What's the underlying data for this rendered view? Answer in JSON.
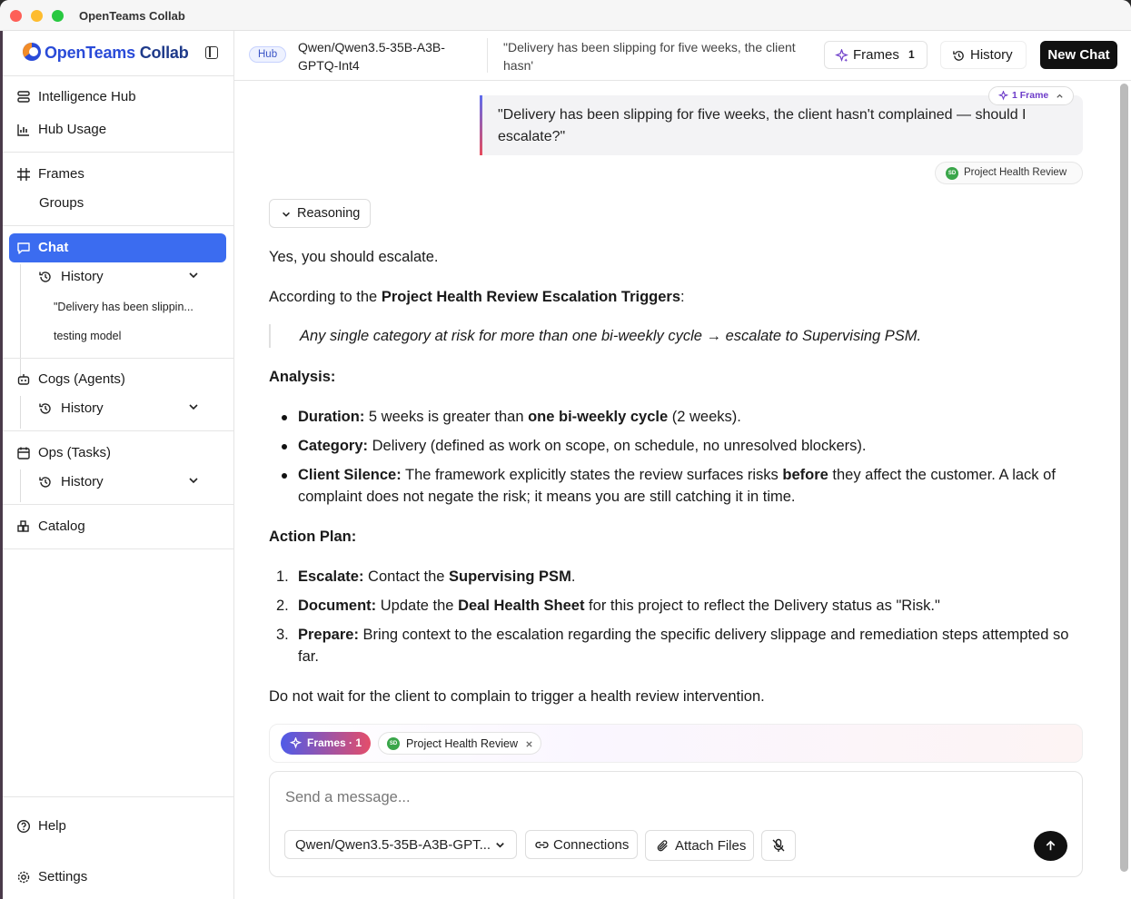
{
  "window": {
    "title": "OpenTeams Collab"
  },
  "colors": {
    "accent": "#3b6cf0",
    "dark_button": "#111111",
    "frames_gradient_start": "#4f5be8",
    "frames_gradient_end": "#e44d6a",
    "tag_green": "#3aa64a"
  },
  "sidebar": {
    "logo_open": "Open",
    "logo_teams": "Teams",
    "logo_collab": " Collab",
    "nav": [
      {
        "label": "Intelligence Hub",
        "icon": "database-icon"
      },
      {
        "label": "Hub Usage",
        "icon": "bar-chart-icon"
      },
      {
        "label": "Frames",
        "icon": "hash-frame-icon"
      },
      {
        "label": "Groups"
      },
      {
        "label": "Chat",
        "icon": "chat-bubble-icon"
      },
      {
        "label": "Cogs (Agents)",
        "icon": "robot-icon"
      },
      {
        "label": "Ops (Tasks)",
        "icon": "calendar-task-icon"
      },
      {
        "label": "Catalog",
        "icon": "catalog-grid-icon"
      },
      {
        "label": "Help",
        "icon": "help-circle-icon"
      },
      {
        "label": "Settings",
        "icon": "gear-icon"
      }
    ],
    "history_label": "History",
    "chat_history": [
      "\"Delivery has been slippin...",
      "testing model"
    ]
  },
  "topbar": {
    "hub_badge": "Hub",
    "model": "Qwen/Qwen3.5-35B-A3B-GPTQ-Int4",
    "conversation_title": "\"Delivery has been slipping for five weeks, the client hasn'",
    "frames_label": "Frames",
    "frames_count": "1",
    "history_label": "History",
    "new_chat_label": "New Chat"
  },
  "thread": {
    "frame_pill": "1 Frame",
    "user_message": "\"Delivery has been slipping for five weeks, the client hasn't complained — should I escalate?\"",
    "frame_tag_initials": "SD",
    "frame_tag": "Project Health Review",
    "reasoning_label": "Reasoning",
    "answer_intro": "Yes, you should escalate.",
    "according_prefix": "According to the ",
    "according_bold": "Project Health Review Escalation Triggers",
    "according_suffix": ":",
    "quote": "Any single category at risk for more than one bi-weekly cycle → escalate to Supervising PSM.",
    "analysis_heading": "Analysis:",
    "analysis": [
      {
        "b1": "Duration:",
        "t1": " 5 weeks is greater than ",
        "b2": "one bi-weekly cycle",
        "t2": " (2 weeks)."
      },
      {
        "b1": "Category:",
        "t1": " Delivery (defined as work on scope, on schedule, no unresolved blockers).",
        "b2": "",
        "t2": ""
      },
      {
        "b1": "Client Silence:",
        "t1": " The framework explicitly states the review surfaces risks ",
        "b2": "before",
        "t2": " they affect the customer. A lack of complaint does not negate the risk; it means you are still catching it in time."
      }
    ],
    "plan_heading": "Action Plan:",
    "plan": [
      {
        "n": "1.",
        "b1": "Escalate:",
        "t1": " Contact the ",
        "b2": "Supervising PSM",
        "t2": "."
      },
      {
        "n": "2.",
        "b1": "Document:",
        "t1": " Update the ",
        "b2": "Deal Health Sheet",
        "t2": " for this project to reflect the Delivery status as \"Risk.\""
      },
      {
        "n": "3.",
        "b1": "Prepare:",
        "t1": " Bring context to the escalation regarding the specific delivery slippage and remediation steps attempted so far.",
        "b2": "",
        "t2": ""
      }
    ],
    "closing": "Do not wait for the client to complain to trigger a health review intervention."
  },
  "composer": {
    "frames_chip": "Frames · 1",
    "frame_chip_initials": "SD",
    "frame_chip_label": "Project Health Review",
    "placeholder": "Send a message...",
    "model_select": "Qwen/Qwen3.5-35B-A3B-GPT...",
    "connections_label": "Connections",
    "attach_label": "Attach Files"
  }
}
